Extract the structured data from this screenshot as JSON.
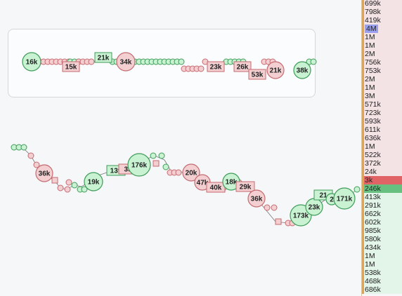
{
  "colors": {
    "buy_fill": "#c8f2d2",
    "buy_stroke": "#3f9b59",
    "sell_fill": "#f4cfd1",
    "sell_stroke": "#c46b71",
    "ask_bg": "#f3e3e4",
    "bid_bg": "#e3f4e8",
    "tick_ask": "#e7a24b",
    "tick_bid": "#e7a24b",
    "spread_ask": "#e06366",
    "spread_bid": "#67c07f",
    "highlight": "#9aa0ee"
  },
  "overview_bubbles": [
    {
      "label": "16k",
      "side": "buy",
      "shape": "circle",
      "size": "large"
    },
    {
      "label": "15k",
      "side": "sell",
      "shape": "rect"
    },
    {
      "label": "21k",
      "side": "buy",
      "shape": "rect"
    },
    {
      "label": "34k",
      "side": "sell",
      "shape": "circle",
      "size": "large"
    },
    {
      "label": "23k",
      "side": "sell",
      "shape": "rect"
    },
    {
      "label": "26k",
      "side": "sell",
      "shape": "rect"
    },
    {
      "label": "53k",
      "side": "sell",
      "shape": "rect"
    },
    {
      "label": "21k",
      "side": "sell",
      "shape": "circle",
      "size": "large"
    },
    {
      "label": "38k",
      "side": "buy",
      "shape": "circle",
      "size": "large"
    }
  ],
  "trade_bubbles": [
    {
      "label": "36k",
      "side": "sell",
      "shape": "circle"
    },
    {
      "label": "19k",
      "side": "buy",
      "shape": "circle"
    },
    {
      "label": "139",
      "side": "buy",
      "shape": "rect"
    },
    {
      "label": "35",
      "side": "sell",
      "shape": "rect"
    },
    {
      "label": "176k",
      "side": "buy",
      "shape": "circle"
    },
    {
      "label": "20k",
      "side": "sell",
      "shape": "circle"
    },
    {
      "label": "47k",
      "side": "sell",
      "shape": "circle"
    },
    {
      "label": "40k",
      "side": "sell",
      "shape": "rect"
    },
    {
      "label": "18k",
      "side": "buy",
      "shape": "circle"
    },
    {
      "label": "29k",
      "side": "sell",
      "shape": "rect"
    },
    {
      "label": "36k",
      "side": "sell",
      "shape": "circle"
    },
    {
      "label": "173k",
      "side": "buy",
      "shape": "circle"
    },
    {
      "label": "23k",
      "side": "buy",
      "shape": "circle"
    },
    {
      "label": "21",
      "side": "buy",
      "shape": "rect"
    },
    {
      "label": "2",
      "side": "buy",
      "shape": "circle"
    },
    {
      "label": "171k",
      "side": "buy",
      "shape": "circle"
    }
  ],
  "depth_book": [
    {
      "label": "699k",
      "side": "ask"
    },
    {
      "label": "798k",
      "side": "ask"
    },
    {
      "label": "419k",
      "side": "ask"
    },
    {
      "label": "4M",
      "side": "ask",
      "highlight": true
    },
    {
      "label": "1M",
      "side": "ask"
    },
    {
      "label": "1M",
      "side": "ask"
    },
    {
      "label": "2M",
      "side": "ask"
    },
    {
      "label": "756k",
      "side": "ask"
    },
    {
      "label": "753k",
      "side": "ask"
    },
    {
      "label": "2M",
      "side": "ask"
    },
    {
      "label": "1M",
      "side": "ask"
    },
    {
      "label": "3M",
      "side": "ask"
    },
    {
      "label": "571k",
      "side": "ask"
    },
    {
      "label": "723k",
      "side": "ask"
    },
    {
      "label": "593k",
      "side": "ask"
    },
    {
      "label": "611k",
      "side": "ask"
    },
    {
      "label": "636k",
      "side": "ask"
    },
    {
      "label": "1M",
      "side": "ask"
    },
    {
      "label": "522k",
      "side": "ask"
    },
    {
      "label": "372k",
      "side": "ask"
    },
    {
      "label": "24k",
      "side": "ask"
    },
    {
      "label": "3k",
      "side": "ask",
      "spread": true
    },
    {
      "label": "246k",
      "side": "bid",
      "spread": true
    },
    {
      "label": "413k",
      "side": "bid"
    },
    {
      "label": "291k",
      "side": "bid"
    },
    {
      "label": "662k",
      "side": "bid"
    },
    {
      "label": "602k",
      "side": "bid"
    },
    {
      "label": "985k",
      "side": "bid"
    },
    {
      "label": "580k",
      "side": "bid"
    },
    {
      "label": "434k",
      "side": "bid"
    },
    {
      "label": "1M",
      "side": "bid"
    },
    {
      "label": "1M",
      "side": "bid"
    },
    {
      "label": "538k",
      "side": "bid"
    },
    {
      "label": "468k",
      "side": "bid"
    },
    {
      "label": "686k",
      "side": "bid"
    }
  ]
}
